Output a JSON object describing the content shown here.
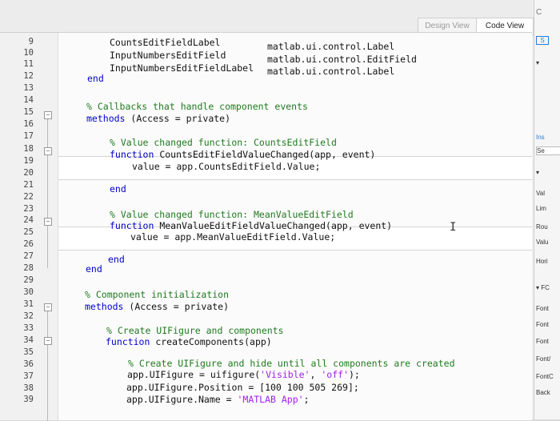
{
  "tabs": {
    "design": "Design View",
    "code": "Code View"
  },
  "line_numbers": [
    "9",
    "10",
    "11",
    "12",
    "13",
    "14",
    "15",
    "16",
    "17",
    "18",
    "19",
    "20",
    "21",
    "22",
    "23",
    "24",
    "25",
    "26",
    "27",
    "28",
    "29",
    "30",
    "31",
    "32",
    "33",
    "34",
    "35",
    "36",
    "37",
    "38",
    "39"
  ],
  "code": {
    "l9a": "CountsEditFieldLabel",
    "l9b": "matlab.ui.control.Label",
    "l10a": "InputNumbersEditField",
    "l10b": "matlab.ui.control.EditField",
    "l11a": "InputNumbersEditFieldLabel",
    "l11b": "matlab.ui.control.Label",
    "l12": "end",
    "l14": "% Callbacks that handle component events",
    "l15kw": "methods",
    "l15rest": " (Access = private)",
    "l17": "% Value changed function: CountsEditField",
    "l18kw": "function",
    "l18rest": " CountsEditFieldValueChanged(app, event)",
    "l19": "value = app.CountsEditField.Value;",
    "l21": "end",
    "l23": "% Value changed function: MeanValueEditField",
    "l24kw": "function",
    "l24rest": " MeanValueEditFieldValueChanged(app, event)",
    "l25": "value = app.MeanValueEditField.Value;",
    "l27": "end",
    "l28": "end",
    "l30": "% Component initialization",
    "l31kw": "methods",
    "l31rest": " (Access = private)",
    "l33": "% Create UIFigure and components",
    "l34kw": "function",
    "l34rest": " createComponents(app)",
    "l36": "% Create UIFigure and hide until all components are created",
    "l37a": "app.UIFigure = uifigure(",
    "l37s1": "'Visible'",
    "l37c": ", ",
    "l37s2": "'off'",
    "l37e": ");",
    "l38": "app.UIFigure.Position = [100 100 505 269];",
    "l39a": "app.UIFigure.Name = ",
    "l39s": "'MATLAB App'",
    "l39e": ";"
  },
  "right_panel": {
    "top": "C",
    "s": "S",
    "ins": "Ins",
    "se": "Se",
    "val": "Val",
    "lim": "Lim",
    "rou": "Rou",
    "valu": "Valu",
    "hori": "Hori",
    "fo": "▾ FC",
    "font1": "Font",
    "font2": "Font",
    "font3": "Font",
    "font4": "Font/",
    "font5": "FontC",
    "back": "Back"
  },
  "colors": {
    "comment": "#1f7a1f",
    "keyword": "#0000cc",
    "string": "#a020f0",
    "warning": "#f0a030"
  }
}
